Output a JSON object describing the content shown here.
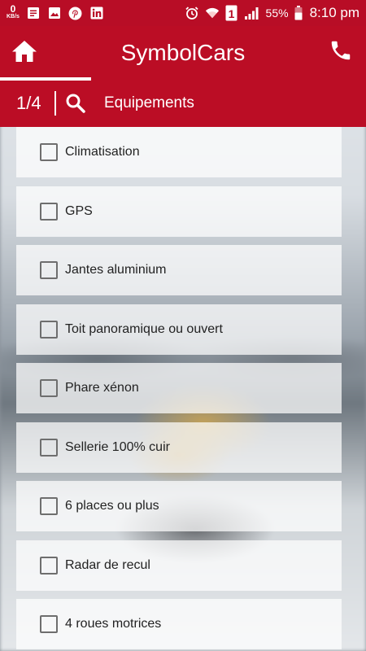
{
  "statusbar": {
    "speed_value": "0",
    "speed_unit": "KB/s",
    "sim_number": "1",
    "battery": "55%",
    "time": "8:10 pm",
    "icons": [
      "data-speed",
      "messages-icon",
      "gallery-icon",
      "pinterest-icon",
      "linkedin-icon",
      "alarm-icon",
      "wifi-icon",
      "sim-icon",
      "signal-icon",
      "battery-icon"
    ]
  },
  "header": {
    "title": "SymbolCars",
    "counter": "1/4",
    "section": "Equipements",
    "icons": [
      "home-icon",
      "phone-icon",
      "search-icon"
    ]
  },
  "colors": {
    "brand": "#bb0d25",
    "statusbar": "#b80d26"
  },
  "items": [
    {
      "label": "Climatisation",
      "checked": false
    },
    {
      "label": "GPS",
      "checked": false
    },
    {
      "label": "Jantes aluminium",
      "checked": false
    },
    {
      "label": "Toit panoramique ou ouvert",
      "checked": false
    },
    {
      "label": "Phare xénon",
      "checked": false
    },
    {
      "label": "Sellerie 100% cuir",
      "checked": false
    },
    {
      "label": "6 places ou plus",
      "checked": false
    },
    {
      "label": "Radar de recul",
      "checked": false
    },
    {
      "label": "4 roues motrices",
      "checked": false
    }
  ]
}
